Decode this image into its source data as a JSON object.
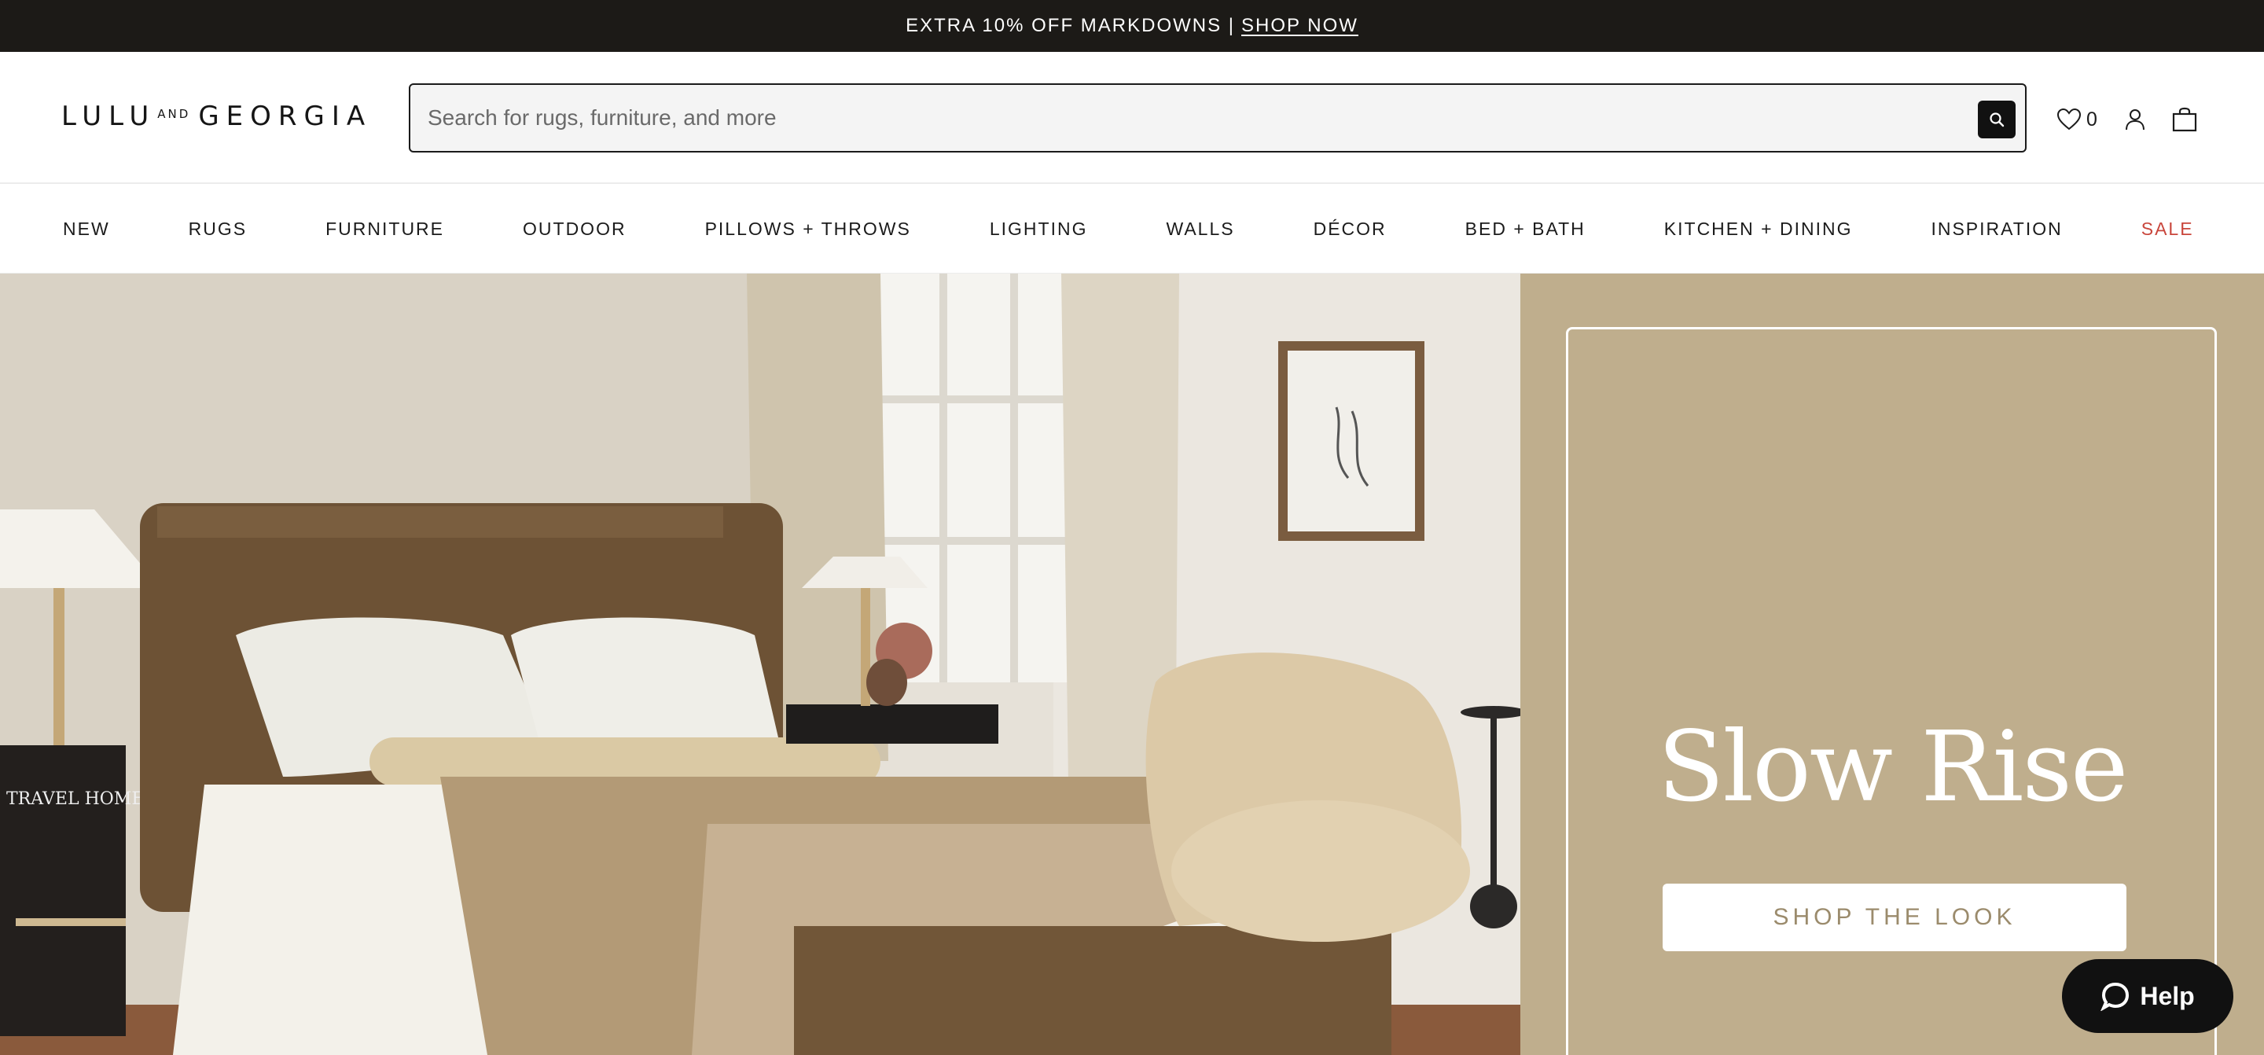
{
  "promo": {
    "text": "EXTRA 10% OFF MARKDOWNS |",
    "link": "SHOP NOW"
  },
  "header": {
    "logo": {
      "part1": "LULU",
      "part2": "AND",
      "part3": "GEORGIA"
    },
    "search_placeholder": "Search for rugs, furniture, and more",
    "wishlist_count": "0"
  },
  "nav": {
    "items": [
      {
        "label": "NEW"
      },
      {
        "label": "RUGS"
      },
      {
        "label": "FURNITURE"
      },
      {
        "label": "OUTDOOR"
      },
      {
        "label": "PILLOWS + THROWS"
      },
      {
        "label": "LIGHTING"
      },
      {
        "label": "WALLS"
      },
      {
        "label": "DÉCOR"
      },
      {
        "label": "BED + BATH"
      },
      {
        "label": "KITCHEN + DINING"
      },
      {
        "label": "INSPIRATION"
      },
      {
        "label": "SALE"
      }
    ]
  },
  "hero": {
    "title": "Slow Rise",
    "cta": "SHOP THE LOOK"
  },
  "help": {
    "label": "Help"
  },
  "colors": {
    "promo_bg": "#1c1a17",
    "panel_bg": "#bfae8d",
    "sale": "#c9463c",
    "cta_text": "#9b8b6c"
  }
}
